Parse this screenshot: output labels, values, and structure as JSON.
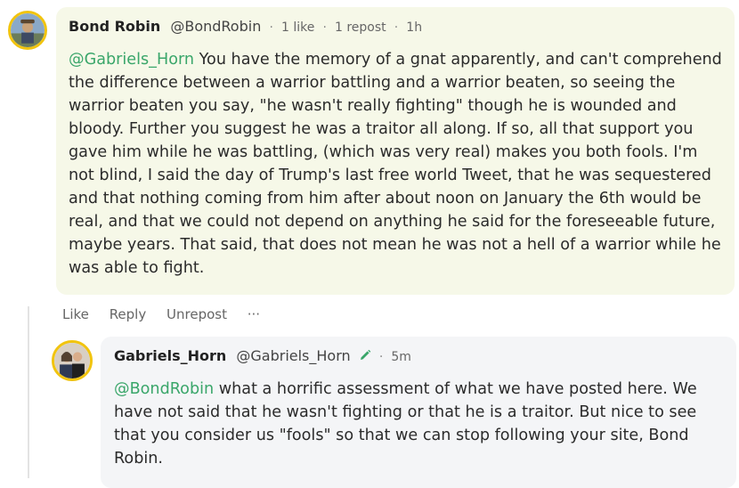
{
  "comment": {
    "author_name": "Bond Robin",
    "author_handle": "@BondRobin",
    "likes": "1 like",
    "reposts": "1 repost",
    "time": "1h",
    "mention": "@Gabriels_Horn",
    "text": " You have the memory of a gnat apparently, and can't comprehend the difference between a warrior battling and a warrior beaten, so seeing the warrior beaten you say, \"he wasn't really fighting\" though he is wounded and bloody. Further you suggest he was a traitor all along. If so, all that support you gave him while he was battling, (which was very real) makes you both fools. I'm not blind, I said the day of Trump's last free world Tweet, that he was sequestered and that nothing coming from him after about noon on January the 6th would be real, and that we could not depend on anything he said for the foreseeable future, maybe years. That said, that does not mean he was not a hell of a warrior while he was able to fight."
  },
  "actions": {
    "like": "Like",
    "reply": "Reply",
    "unrepost": "Unrepost",
    "more": "···"
  },
  "reply": {
    "author_name": "Gabriels_Horn",
    "author_handle": "@Gabriels_Horn",
    "time": "5m",
    "mention": "@BondRobin",
    "text": " what a horrific assessment of what we have posted here. We have not said that he wasn't fighting or that he is a traitor. But nice to see that you consider us \"fools\" so that we can stop following your site, Bond Robin."
  },
  "colors": {
    "mention": "#3aa66a",
    "avatar_border": "#f1c40f",
    "comment_bg": "#f6f8e8",
    "reply_bg": "#f4f5f7"
  },
  "icons": {
    "author_badge": "pencil-icon"
  }
}
